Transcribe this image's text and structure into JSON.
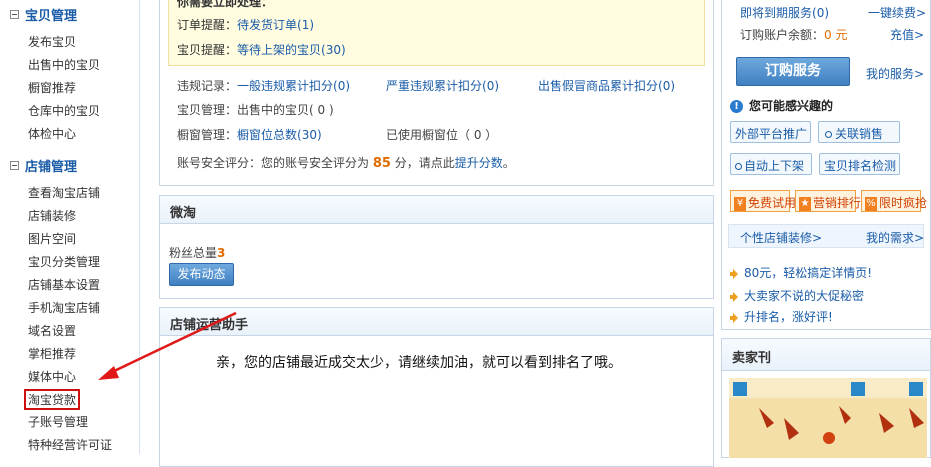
{
  "sidebar": {
    "section1": "宝贝管理",
    "items1": [
      "发布宝贝",
      "出售中的宝贝",
      "橱窗推荐",
      "仓库中的宝贝",
      "体检中心"
    ],
    "section2": "店铺管理",
    "items2": [
      "查看淘宝店铺",
      "店铺装修",
      "图片空间",
      "宝贝分类管理",
      "店铺基本设置",
      "手机淘宝店铺",
      "域名设置",
      "掌柜推荐",
      "媒体中心",
      "淘宝贷款",
      "子账号管理",
      "特种经营许可证"
    ]
  },
  "alerts": {
    "heading": "你需要立即处理：",
    "order_label": "订单提醒：",
    "order_link": "待发货订单",
    "order_count": "(1)",
    "item_label": "宝贝提醒：",
    "item_link": "等待上架的宝贝",
    "item_count": "(30)"
  },
  "stats": {
    "violation_label": "违规记录：",
    "general_link": "一般违规累计扣分",
    "general_count": "(0)",
    "serious_link": "严重违规累计扣分",
    "serious_count": "(0)",
    "fake_link": "出售假冒商品累计扣分",
    "fake_count": "(0)",
    "goods_label": "宝贝管理：出售中的宝贝",
    "goods_count": "( 0 )",
    "window_label": "橱窗管理：",
    "window_link": "橱窗位总数",
    "window_count": "(30)",
    "window_used": "已使用橱窗位（ 0 ）",
    "security_prefix": "账号安全评分：您的账号安全评分为",
    "security_score": "85",
    "security_mid": "分，请点此",
    "security_link": "提升分数",
    "security_end": "。"
  },
  "weitao": {
    "title": "微淘",
    "fans_label": "粉丝总量",
    "fans_count": "3",
    "publish_button": "发布动态"
  },
  "assistant": {
    "title": "店铺运营助手",
    "message": "亲，您的店铺最近成交太少，请继续加油，就可以看到排名了哦。"
  },
  "right": {
    "expiring_label": "即将到期服务",
    "expiring_count": "(0)",
    "renew_link": "一键续费>",
    "balance_label": "订购账户余额：",
    "balance_value": "0 元",
    "recharge_link": "充值>",
    "order_service_button": "订购服务",
    "my_service_link": "我的服务>",
    "interest_title": "您可能感兴趣的",
    "chips": [
      "外部平台推广",
      "关联销售",
      "自动上下架",
      "宝贝排名检测"
    ],
    "promo_chips": [
      "免费试用",
      "营销排行",
      "限时疯抢"
    ],
    "custom_deco_link": "个性店铺装修>",
    "my_needs_link": "我的需求>",
    "news": [
      "80元，轻松搞定详情页!",
      "大卖家不说的大促秘密",
      "升排名，涨好评!"
    ],
    "seller_mag_title": "卖家刊"
  },
  "colors": {
    "link": "#1a5ca8",
    "highlight_border": "#d01010",
    "arrow": "#e01818",
    "score": "#e06c00"
  }
}
